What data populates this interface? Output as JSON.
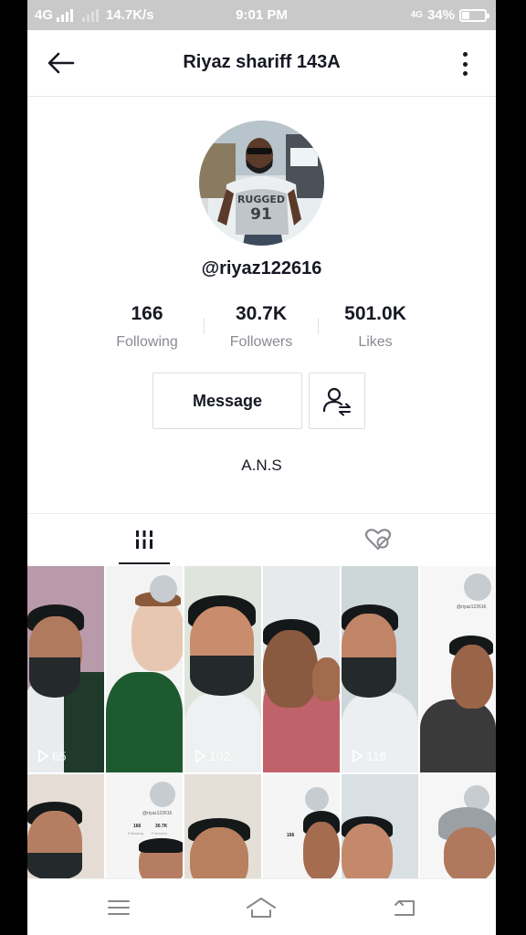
{
  "status_bar": {
    "network": "4G",
    "speed": "14.7K/s",
    "time": "9:01 PM",
    "network_right": "4G",
    "battery": "34%",
    "battery_level": 0.34
  },
  "header": {
    "title": "Riyaz shariff 143A",
    "back_icon": "arrow-left-icon",
    "more_icon": "more-vertical-icon"
  },
  "profile": {
    "handle": "@riyaz122616",
    "stats": [
      {
        "value": "166",
        "label": "Following"
      },
      {
        "value": "30.7K",
        "label": "Followers"
      },
      {
        "value": "501.0K",
        "label": "Likes"
      }
    ],
    "message_label": "Message",
    "follow_icon": "add-friend-icon",
    "bio": "A.N.S"
  },
  "tabs": [
    {
      "icon": "videos-grid-icon",
      "active": true
    },
    {
      "icon": "liked-hidden-icon",
      "active": false
    }
  ],
  "videos": [
    {
      "views": "65"
    },
    {
      "views": ""
    },
    {
      "views": "102"
    },
    {
      "views": ""
    },
    {
      "views": "116"
    },
    {
      "views": ""
    },
    {
      "views": ""
    },
    {
      "views": ""
    },
    {
      "views": ""
    },
    {
      "views": ""
    },
    {
      "views": ""
    },
    {
      "views": ""
    }
  ],
  "thumb_text": {
    "mini_handle": "@riyaz122616",
    "mini_following": "166",
    "mini_followers": "30.7K",
    "mini_label_following": "Following",
    "mini_label_followers": "Followers"
  },
  "nav": {
    "menu_icon": "menu-icon",
    "home_icon": "home-icon",
    "back_icon": "back-icon"
  },
  "colors": {
    "text": "#161823",
    "secondary": "#8a8b91",
    "status_bar": "#c9c9c9"
  }
}
